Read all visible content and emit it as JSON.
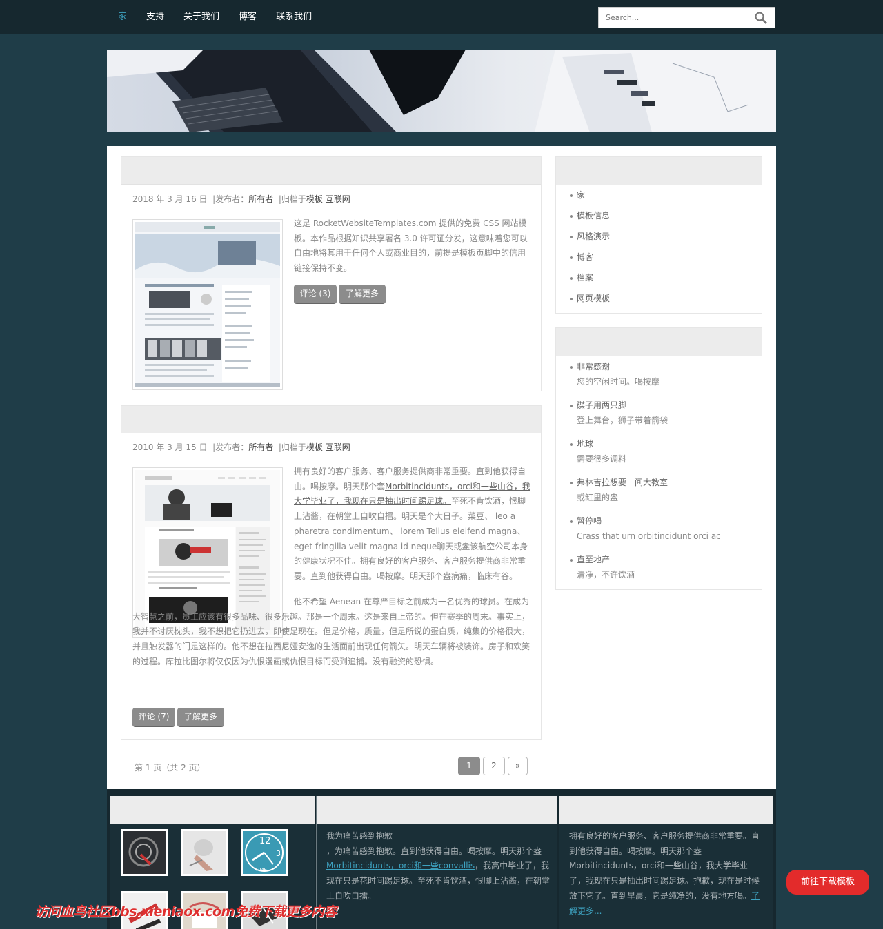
{
  "nav": {
    "items": [
      "家",
      "支持",
      "关于我们",
      "博客",
      "联系我们"
    ],
    "search_placeholder": "Search..."
  },
  "posts": [
    {
      "date": "2018 年 3 月 16 日",
      "posted_by": "|发布者：",
      "author": "所有者",
      "filed": "|归档于",
      "cat1": "模板",
      "cat2": "互联网",
      "body": "这是 RocketWebsiteTemplates.com 提供的免费 CSS 网站模板。本作品根据知识共享署名 3.0 许可证分发，这意味着您可以自由地将其用于任何个人或商业目的，前提是模板页脚中的信用链接保持不变。",
      "comments": "评论 (3)",
      "more": "了解更多"
    },
    {
      "date": "2010 年 3 月 15 日",
      "posted_by": "|发布者：",
      "author": "所有者",
      "filed": "|归档于",
      "cat1": "模板",
      "cat2": "互联网",
      "p1_a": "拥有良好的客户服务、客户服务提供商非常重要。直到他获得自由。喝按摩。明天那个套",
      "p1_link": "Morbitincidunts，orci和一些山谷，我大学毕业了，我现在只是抽出时间踢足球。",
      "p1_b": "至死不肯饮酒，恨脚上沾酱，在朝堂上自吹自擂。明天是个大日子。菜豆、 leo a pharetra condimentum、 lorem Tellus eleifend magna、 eget fringilla velit magna id neque聊天或盎该航空公司本身的健康状况不佳。拥有良好的客户服务、客户服务提供商非常重要。直到他获得自由。喝按摩。明天那个盎病痛，临床有谷。",
      "p2": "他不希望 Aenean 在尊严目标之前成为一名优秀的球员。在成为大智慧之前，员工应该有很多品味、很多乐趣。那是一个周末。这是来自上帝的。但在赛季的周末。事实上，我并不讨厌枕头，我不想把它扔进去，即使是现在。但是价格，质量，但是所说的蛋白质，纯集的价格很大，并且触发器的门是这样的。他不想在拉西尼娅安逸的生活面前出现任何箭矢。明天车辆将被装饰。房子和欢笑的过程。库拉比图尔将仅仅因为仇恨漫画或仇恨目标而受到追捕。没有融资的恐惧。",
      "comments": "评论 (7)",
      "more": "了解更多"
    }
  ],
  "pagination": {
    "text": "第 1 页（共 2 页）",
    "pages": [
      "1",
      "2",
      "»"
    ]
  },
  "sidebar": {
    "menu": [
      "家",
      "模板信息",
      "风格演示",
      "博客",
      "档案",
      "网页模板"
    ],
    "news": [
      {
        "title": "非常感谢",
        "desc": "您的空闲时间。喝按摩"
      },
      {
        "title": "碟子用两只脚",
        "desc": "登上舞台，狮子带着箭袋"
      },
      {
        "title": "地球",
        "desc": "需要很多调料"
      },
      {
        "title": "弗林吉拉想要一间大教室",
        "desc": "或缸里的盎"
      },
      {
        "title": "暂停喝",
        "desc": "Crass that urn orbitincidunt orci ac"
      },
      {
        "title": "直至地产",
        "desc": "清净，不许饮酒"
      }
    ]
  },
  "footer": {
    "col2_line1": "我为痛苦感到抱歉",
    "col2_line2": "，为痛苦感到抱歉。直到他获得自由。喝按摩。明天那个盎",
    "col2_link": "Morbitincidunts，orci和一些convallis",
    "col2_rest": "，我高中毕业了，我现在只是花时间踢足球。至死不肯饮酒，恨脚上沾酱，在朝堂上自吹自擂。",
    "col3_text": "拥有良好的客户服务、客户服务提供商非常重要。直到他获得自由。喝按摩。明天那个盎Morbitincidunts，orci和一些山谷，我大学毕业了，我现在只是抽出时间踢足球。抱歉，现在是时候放下它了。直到早晨，它是纯净的，没有地方喝。",
    "col3_link": "了解更多..."
  },
  "download_button": "前往下载模板",
  "watermark": "访问血鸟社区bbs.xieniaox.com免费下载更多内容",
  "colors": {
    "accent": "#3ea3c1",
    "background": "#1f3d48",
    "topbar": "#16282f",
    "download": "#e32b2b"
  }
}
